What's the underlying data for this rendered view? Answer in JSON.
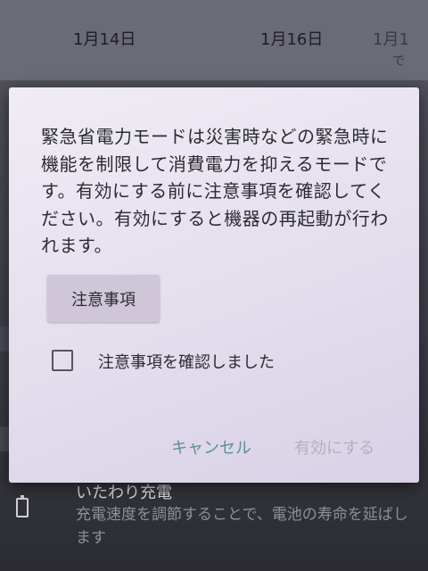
{
  "background": {
    "dates": [
      "1月14日",
      "1月16日",
      "1月1"
    ],
    "header_sub": "で",
    "list_item": {
      "title": "いたわり充電",
      "description": "充電速度を調節することで、電池の寿命を延ばします",
      "icon": "battery-icon"
    }
  },
  "dialog": {
    "message": "緊急省電力モードは災害時などの緊急時に機能を制限して消費電力を抑えるモードです。有効にする前に注意事項を確認してください。有効にすると機器の再起動が行われます。",
    "notes_button_label": "注意事項",
    "confirm_checkbox_label": "注意事項を確認しました",
    "confirm_checked": false,
    "cancel_label": "キャンセル",
    "enable_label": "有効にする",
    "enable_enabled": false
  },
  "colors": {
    "dialog_bg": "#e6e0ee",
    "accent": "#5a8f9b",
    "disabled_text": "#b5b0bc"
  }
}
